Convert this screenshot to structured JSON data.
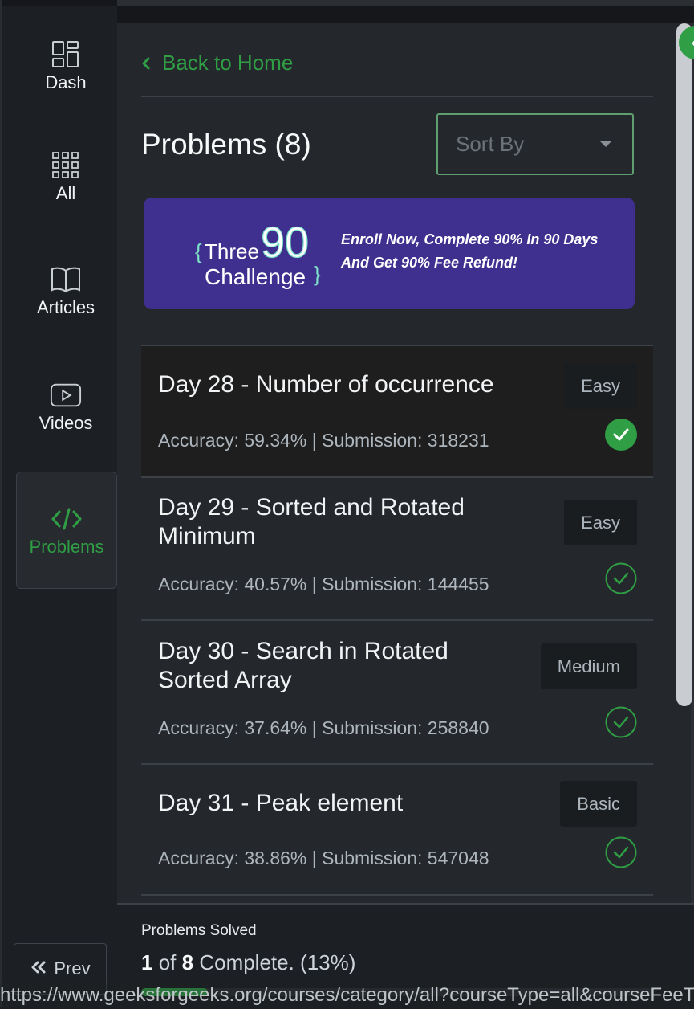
{
  "sidebar": {
    "items": [
      {
        "label": "Dash",
        "icon": "dashboard-icon"
      },
      {
        "label": "All",
        "icon": "grid-icon"
      },
      {
        "label": "Articles",
        "icon": "book-icon"
      },
      {
        "label": "Videos",
        "icon": "play-icon"
      },
      {
        "label": "Problems",
        "icon": "code-icon",
        "active": true
      }
    ],
    "prev_label": "Prev"
  },
  "header": {
    "back_label": "Back to Home",
    "title": "Problems (8)",
    "sort_placeholder": "Sort By"
  },
  "banner": {
    "logo_three": "Three",
    "logo_ninety": "90",
    "logo_challenge": "Challenge",
    "text": "Enroll Now, Complete 90% In 90 Days And Get 90% Fee Refund!"
  },
  "problems": [
    {
      "title": "Day 28 - Number of occurrence",
      "stats": "Accuracy: 59.34% | Submission: 318231",
      "difficulty": "Easy",
      "solved": true
    },
    {
      "title": "Day 29 - Sorted and Rotated Minimum",
      "stats": "Accuracy: 40.57% | Submission: 144455",
      "difficulty": "Easy",
      "solved": false
    },
    {
      "title": "Day 30 - Search in Rotated Sorted Array",
      "stats": "Accuracy: 37.64% | Submission: 258840",
      "difficulty": "Medium",
      "solved": false
    },
    {
      "title": "Day 31 - Peak element",
      "stats": "Accuracy: 38.86% | Submission: 547048",
      "difficulty": "Basic",
      "solved": false
    }
  ],
  "progress": {
    "label": "Problems Solved",
    "solved": "1",
    "of_word": "of",
    "total": "8",
    "suffix": "Complete. (13%)",
    "fraction": 0.13
  },
  "status_url": "https://www.geeksforgeeks.org/courses/category/all?courseType=all&courseFeeTy",
  "colors": {
    "accent": "#2f9e44",
    "banner": "#3f2f8f"
  }
}
